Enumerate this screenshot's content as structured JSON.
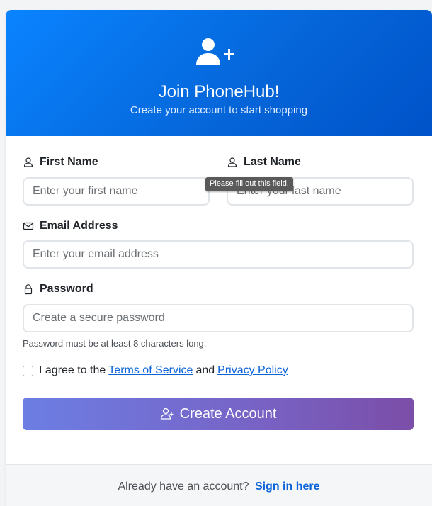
{
  "header": {
    "icon": "user-plus-icon",
    "title": "Join PhoneHub!",
    "subtitle": "Create your account to start shopping",
    "gradient_start": "#0a84ff",
    "gradient_end": "#0052c9"
  },
  "form": {
    "first_name": {
      "label": "First Name",
      "icon": "user-icon",
      "placeholder": "Enter your first name",
      "value": ""
    },
    "last_name": {
      "label": "Last Name",
      "icon": "user-icon",
      "placeholder": "Enter your last name",
      "value": ""
    },
    "email": {
      "label": "Email Address",
      "icon": "envelope-icon",
      "placeholder": "Enter your email address",
      "value": ""
    },
    "password": {
      "label": "Password",
      "icon": "lock-icon",
      "placeholder": "Create a secure password",
      "value": "",
      "hint": "Password must be at least 8 characters long."
    },
    "terms": {
      "checked": false,
      "prefix": "I agree to the",
      "terms_link": "Terms of Service",
      "conjunction": "and",
      "privacy_link": "Privacy Policy"
    },
    "submit": {
      "label": "Create Account",
      "icon": "user-plus-icon"
    },
    "validation_tooltip": "Please fill out this field."
  },
  "footer": {
    "prompt": "Already have an account?",
    "link": "Sign in here"
  },
  "colors": {
    "link": "#0a63d8",
    "button_start": "#6c7ee3",
    "button_end": "#7b4ea8"
  }
}
